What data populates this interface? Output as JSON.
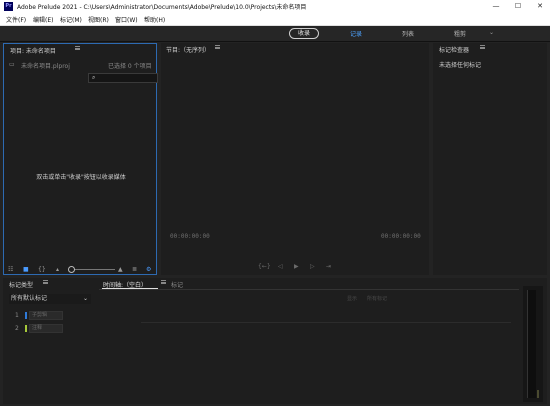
{
  "window": {
    "app_badge": "Pr",
    "title": "Adobe Prelude 2021 - C:\\Users\\Administrator\\Documents\\Adobe\\Prelude\\10.0\\Projects\\未命名项目",
    "minimize": "—",
    "maximize": "☐",
    "close": "✕"
  },
  "menu": [
    "文件(F)",
    "编辑(E)",
    "标记(M)",
    "视图(R)",
    "窗口(W)",
    "帮助(H)"
  ],
  "workspace": {
    "ingest_button": "收录",
    "tabs": [
      {
        "label": "记录",
        "active": true
      },
      {
        "label": "列表",
        "active": false
      },
      {
        "label": "粗剪",
        "active": false
      }
    ],
    "chevron": "⌄"
  },
  "project_panel": {
    "title": "项目: 未命名项目",
    "file_name": "未命名项目.plproj",
    "selected_count": "已选择 0 个项目",
    "drop_hint": "双击或单击\"收录\"按钮以收录媒体"
  },
  "monitor_panel": {
    "title": "节目:（无序列）",
    "timecode_left": "00:00:00:00",
    "timecode_right": "00:00:00:00",
    "transport": [
      "{←}",
      "◁",
      "▶",
      "▷",
      "⇥"
    ]
  },
  "inspector_panel": {
    "title": "标记检查器",
    "empty_text": "未选择任何标记"
  },
  "marker_type_panel": {
    "title": "标记类型",
    "selected": "所有默认标记",
    "rows": [
      {
        "key": "1",
        "label": "子剪辑",
        "color": "#2f7ad8"
      },
      {
        "key": "2",
        "label": "注释",
        "color": "#a7c93a"
      }
    ]
  },
  "timeline_panel": {
    "tabs": [
      {
        "label": "时间轴:（空白）",
        "active": true
      },
      {
        "label": "标记",
        "active": false
      }
    ],
    "display_label": "显示",
    "display_value": "所有标记"
  },
  "colors": {
    "accent": "#2d6ab2",
    "ws_active": "#4da3ff"
  },
  "icons": [
    "app-icon",
    "search-icon",
    "list-view-icon",
    "icon-view-icon",
    "freeform-view-icon",
    "zoom-out-icon",
    "zoom-in-icon",
    "new-item-icon",
    "hamburger-menu-icon"
  ]
}
